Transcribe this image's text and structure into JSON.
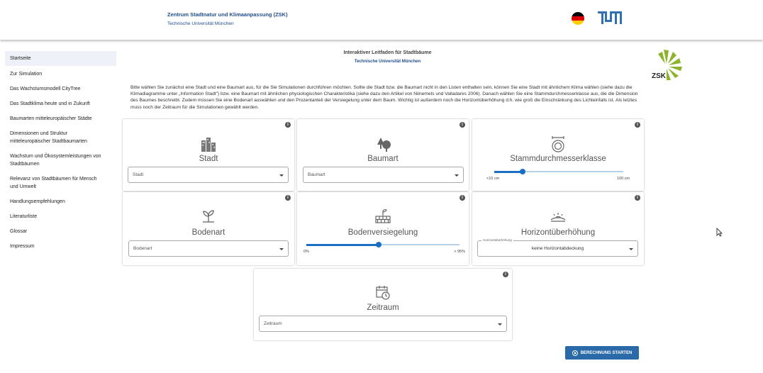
{
  "header": {
    "title": "Zentrum Stadtnatur und Klimaanpassung (ZSK)",
    "subtitle": "Technische Universität München",
    "flag_colors": [
      "#000000",
      "#dd0000",
      "#ffce00"
    ],
    "logo_color": "#3070b3"
  },
  "sidebar": {
    "items": [
      {
        "label": "Startseite"
      },
      {
        "label": "Zur Simulation"
      },
      {
        "label": "Das Wachstumsmodell CityTree"
      },
      {
        "label": "Das Stadtklima heute und in Zukunft"
      },
      {
        "label": "Baumarten mitteleuropäischer Städte"
      },
      {
        "label": "Dimensionen und Struktur mitteleuropäischer Stadtbaumarten"
      },
      {
        "label": "Wachstum und Ökosystemleistungen von Stadtbäumen"
      },
      {
        "label": "Relevanz von Stadtbäumen für Mensch und Umwelt"
      },
      {
        "label": "Handlungsempfehlungen"
      },
      {
        "label": "Literaturliste"
      },
      {
        "label": "Glossar"
      },
      {
        "label": "Impressum"
      }
    ]
  },
  "main": {
    "title": "Interaktiver Leitfaden für Stadtbäume",
    "subtitle": "Technische Universität München",
    "logo_text": "ZSK",
    "intro": "Bitte wählen Sie zunächst eine Stadt und eine Baumart aus, für die Sie Simulationen durchführen möchten. Sollte die Stadt bzw. die Baumart nicht in den Listen enthalten sein, können Sie eine Stadt mit ähnlichem Klima wählen (siehe dazu die Klimadiagramme unter „Information Stadt\") bzw. eine Baumart mit ähnlichen physiologischen Charakteristika (siehe dazu den Artikel von Niinemets und Valladares 2006). Danach wählen Sie eine Stammdurchmesserklasse aus, die die Dimension des Baumes beschreibt. Zudem müssen Sie eine Bodenart auswählen und den Prozentanteil der Versiegelung unter dem Baum. Wichtig ist außerdem noch die Horizontüberhöhung d.h. wie groß die Einschränkung des Lichteinfalls ist. Als letztes muss noch der Zeitraum für die Simulationen gewählt werden."
  },
  "cards": {
    "stadt": {
      "title": "Stadt",
      "select_value": "Stadt"
    },
    "baumart": {
      "title": "Baumart",
      "select_value": "Baumart"
    },
    "stamm": {
      "title": "Stammdurchmesserklasse",
      "min_label": "<10 cm",
      "max_label": "100 cm",
      "value_fraction": 0.22
    },
    "boden": {
      "title": "Bodenart",
      "select_value": "Bodenart"
    },
    "versiegelung": {
      "title": "Bodenversiegelung",
      "min_label": "0%",
      "max_label": "> 95%",
      "value_fraction": 0.47
    },
    "horizont": {
      "title": "Horizontüberhöhung",
      "legend": "Horizontüberhöhung",
      "select_value": "keine Horizontabdeckung"
    },
    "zeitraum": {
      "title": "Zeitraum",
      "select_value": "Zeitraum"
    },
    "info_glyph": "i"
  },
  "actions": {
    "start_label": "BERECHNUNG STARTEN",
    "accent": "#2a6aa8"
  }
}
